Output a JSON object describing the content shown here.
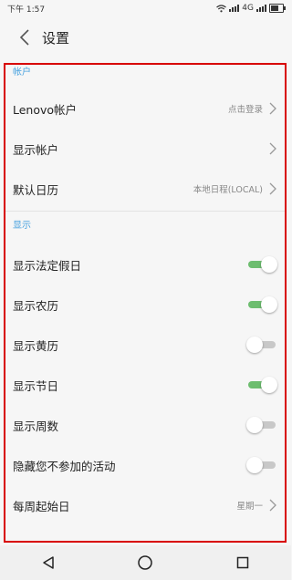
{
  "status_bar": {
    "time": "下午 1:57",
    "network": "4G"
  },
  "header": {
    "title": "设置"
  },
  "sections": {
    "account": {
      "label": "帐户"
    },
    "display": {
      "label": "显示"
    }
  },
  "rows": {
    "lenovo_account": {
      "label": "Lenovo帐户",
      "value": "点击登录"
    },
    "show_account": {
      "label": "显示帐户"
    },
    "default_calendar": {
      "label": "默认日历",
      "value": "本地日程(LOCAL)"
    },
    "legal_holidays": {
      "label": "显示法定假日",
      "checked": true
    },
    "lunar": {
      "label": "显示农历",
      "checked": true
    },
    "almanac": {
      "label": "显示黄历",
      "checked": false
    },
    "festivals": {
      "label": "显示节日",
      "checked": true
    },
    "week_number": {
      "label": "显示周数",
      "checked": false
    },
    "hide_declined": {
      "label": "隐藏您不参加的活动",
      "checked": false
    },
    "week_start": {
      "label": "每周起始日",
      "value": "星期一"
    }
  },
  "colors": {
    "accent": "#4aa3df",
    "toggle_on": "#6dbd6f",
    "highlight_border": "#d80000"
  },
  "icons": [
    "wifi-icon",
    "signal-icon",
    "battery-icon",
    "back-arrow-icon",
    "chevron-right-icon",
    "nav-back-icon",
    "nav-home-icon",
    "nav-recents-icon"
  ]
}
